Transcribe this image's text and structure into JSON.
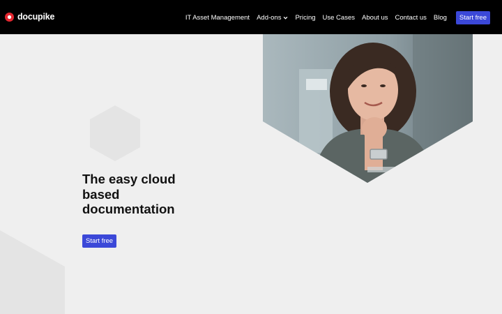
{
  "brand": {
    "name": "docupike",
    "accent": "#e3262f"
  },
  "nav": {
    "items": [
      {
        "label": "IT Asset Management"
      },
      {
        "label": "Add-ons",
        "icon": "chevron-down-icon"
      },
      {
        "label": "Pricing"
      },
      {
        "label": "Use Cases"
      },
      {
        "label": "About us"
      },
      {
        "label": "Contact us"
      },
      {
        "label": "Blog"
      }
    ],
    "cta_label": "Start free"
  },
  "hero": {
    "title": "The easy cloud based documentation",
    "cta_label": "Start free",
    "image": "smiling-woman-photo"
  },
  "colors": {
    "header_bg": "#000000",
    "page_bg": "#efefef",
    "button": "#3b48d8"
  }
}
